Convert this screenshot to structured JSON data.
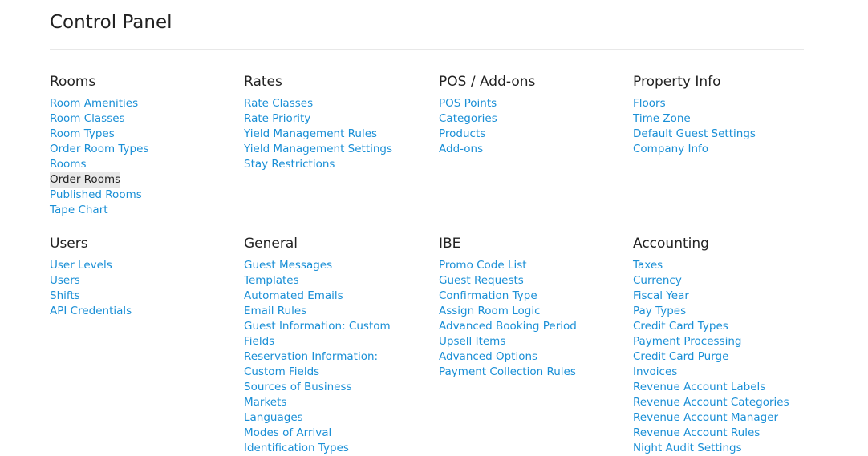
{
  "page": {
    "title": "Control Panel"
  },
  "sections": {
    "rooms": {
      "title": "Rooms",
      "items": [
        "Room Amenities",
        "Room Classes",
        "Room Types",
        "Order Room Types",
        "Rooms",
        "Order Rooms",
        "Published Rooms",
        "Tape Chart"
      ]
    },
    "rates": {
      "title": "Rates",
      "items": [
        "Rate Classes",
        "Rate Priority",
        "Yield Management Rules",
        "Yield Management Settings",
        "Stay Restrictions"
      ]
    },
    "pos": {
      "title": "POS / Add-ons",
      "items": [
        "POS Points",
        "Categories",
        "Products",
        "Add-ons"
      ]
    },
    "property": {
      "title": "Property Info",
      "items": [
        "Floors",
        "Time Zone",
        "Default Guest Settings",
        "Company Info"
      ]
    },
    "users": {
      "title": "Users",
      "items": [
        "User Levels",
        "Users",
        "Shifts",
        "API Credentials"
      ]
    },
    "general": {
      "title": "General",
      "items": [
        "Guest Messages",
        "Templates",
        "Automated Emails",
        "Email Rules",
        "Guest Information: Custom Fields",
        "Reservation Information: Custom Fields",
        "Sources of Business",
        "Markets",
        "Languages",
        "Modes of Arrival",
        "Identification Types"
      ]
    },
    "ibe": {
      "title": "IBE",
      "items": [
        "Promo Code List",
        "Guest Requests",
        "Confirmation Type",
        "Assign Room Logic",
        "Advanced Booking Period",
        "Upsell Items",
        "Advanced Options",
        "Payment Collection Rules"
      ]
    },
    "accounting": {
      "title": "Accounting",
      "items": [
        "Taxes",
        "Currency",
        "Fiscal Year",
        "Pay Types",
        "Credit Card Types",
        "Payment Processing",
        "Credit Card Purge",
        "Invoices",
        "Revenue Account Labels",
        "Revenue Account Categories",
        "Revenue Account Manager",
        "Revenue Account Rules",
        "Night Audit Settings"
      ]
    }
  },
  "colors": {
    "link": "#1a8fd6",
    "heading": "#222222",
    "active_bg": "#e8e8e8"
  },
  "active_item": "Order Rooms"
}
